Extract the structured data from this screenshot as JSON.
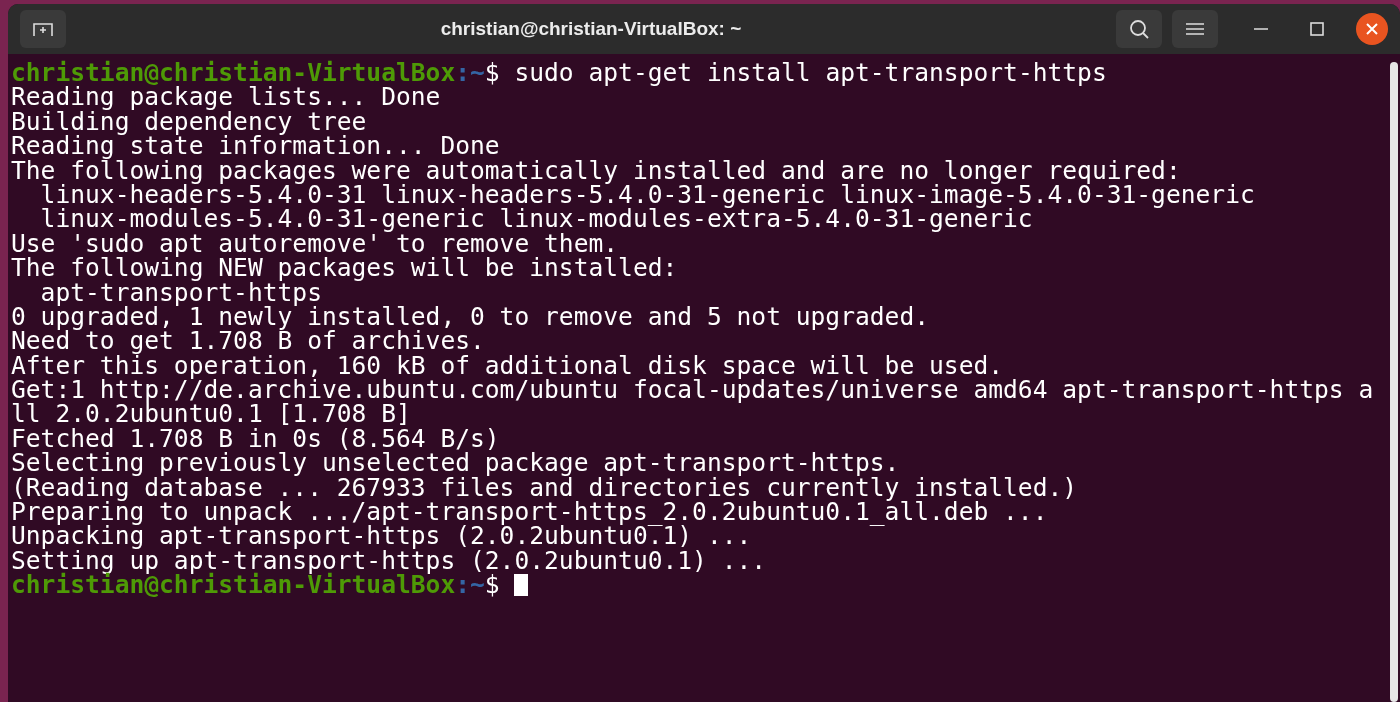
{
  "window": {
    "title": "christian@christian-VirtualBox: ~"
  },
  "terminal": {
    "lines": [
      {
        "kind": "prompt",
        "user": "christian@christian-VirtualBox",
        "path": ":~",
        "symbol": "$ ",
        "command": "sudo apt-get install apt-transport-https"
      },
      {
        "kind": "output",
        "text": "Reading package lists... Done"
      },
      {
        "kind": "output",
        "text": "Building dependency tree"
      },
      {
        "kind": "output",
        "text": "Reading state information... Done"
      },
      {
        "kind": "output",
        "text": "The following packages were automatically installed and are no longer required:"
      },
      {
        "kind": "output",
        "text": "  linux-headers-5.4.0-31 linux-headers-5.4.0-31-generic linux-image-5.4.0-31-generic"
      },
      {
        "kind": "output",
        "text": "  linux-modules-5.4.0-31-generic linux-modules-extra-5.4.0-31-generic"
      },
      {
        "kind": "output",
        "text": "Use 'sudo apt autoremove' to remove them."
      },
      {
        "kind": "output",
        "text": "The following NEW packages will be installed:"
      },
      {
        "kind": "output",
        "text": "  apt-transport-https"
      },
      {
        "kind": "output",
        "text": "0 upgraded, 1 newly installed, 0 to remove and 5 not upgraded."
      },
      {
        "kind": "output",
        "text": "Need to get 1.708 B of archives."
      },
      {
        "kind": "output",
        "text": "After this operation, 160 kB of additional disk space will be used."
      },
      {
        "kind": "output",
        "text": "Get:1 http://de.archive.ubuntu.com/ubuntu focal-updates/universe amd64 apt-transport-https a"
      },
      {
        "kind": "output",
        "text": "ll 2.0.2ubuntu0.1 [1.708 B]"
      },
      {
        "kind": "output",
        "text": "Fetched 1.708 B in 0s (8.564 B/s)"
      },
      {
        "kind": "output",
        "text": "Selecting previously unselected package apt-transport-https."
      },
      {
        "kind": "output",
        "text": "(Reading database ... 267933 files and directories currently installed.)"
      },
      {
        "kind": "output",
        "text": "Preparing to unpack .../apt-transport-https_2.0.2ubuntu0.1_all.deb ..."
      },
      {
        "kind": "output",
        "text": "Unpacking apt-transport-https (2.0.2ubuntu0.1) ..."
      },
      {
        "kind": "output",
        "text": "Setting up apt-transport-https (2.0.2ubuntu0.1) ..."
      },
      {
        "kind": "prompt",
        "user": "christian@christian-VirtualBox",
        "path": ":~",
        "symbol": "$ ",
        "cursor": true
      }
    ]
  }
}
